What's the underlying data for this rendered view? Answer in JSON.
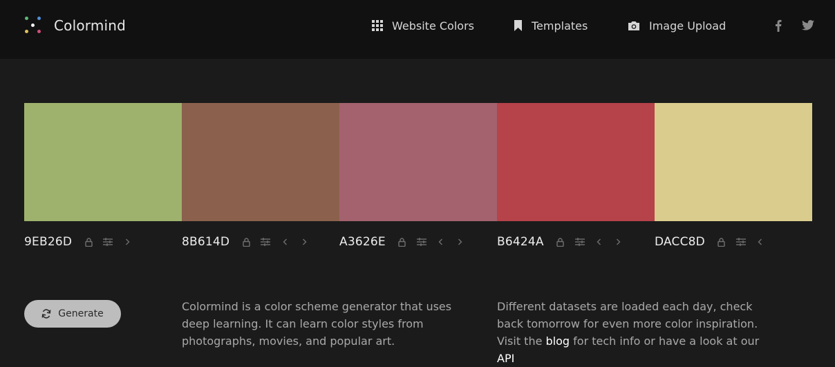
{
  "brand": {
    "name": "Colormind"
  },
  "nav": [
    {
      "label": "Website Colors",
      "icon": "grid-icon"
    },
    {
      "label": "Templates",
      "icon": "bookmark-icon"
    },
    {
      "label": "Image Upload",
      "icon": "camera-icon"
    }
  ],
  "social": [
    "facebook-icon",
    "twitter-icon"
  ],
  "palette": [
    {
      "hex": "9EB26D",
      "color": "#9EB26D",
      "left_arrow": false,
      "right_arrow": true
    },
    {
      "hex": "8B614D",
      "color": "#8B614D",
      "left_arrow": true,
      "right_arrow": true
    },
    {
      "hex": "A3626E",
      "color": "#A3626E",
      "left_arrow": true,
      "right_arrow": true
    },
    {
      "hex": "B6424A",
      "color": "#B6424A",
      "left_arrow": true,
      "right_arrow": true
    },
    {
      "hex": "DACC8D",
      "color": "#DACC8D",
      "left_arrow": true,
      "right_arrow": false
    }
  ],
  "generate": {
    "label": "Generate"
  },
  "about": {
    "text": "Colormind is a color scheme generator that uses deep learning. It can learn color styles from photographs, movies, and popular art."
  },
  "datasets": {
    "text_before": "Different datasets are loaded each day, check back tomorrow for even more color inspiration. Visit the ",
    "blog_link": "blog",
    "text_middle": " for tech info or have a look at our ",
    "api_link": "API"
  }
}
